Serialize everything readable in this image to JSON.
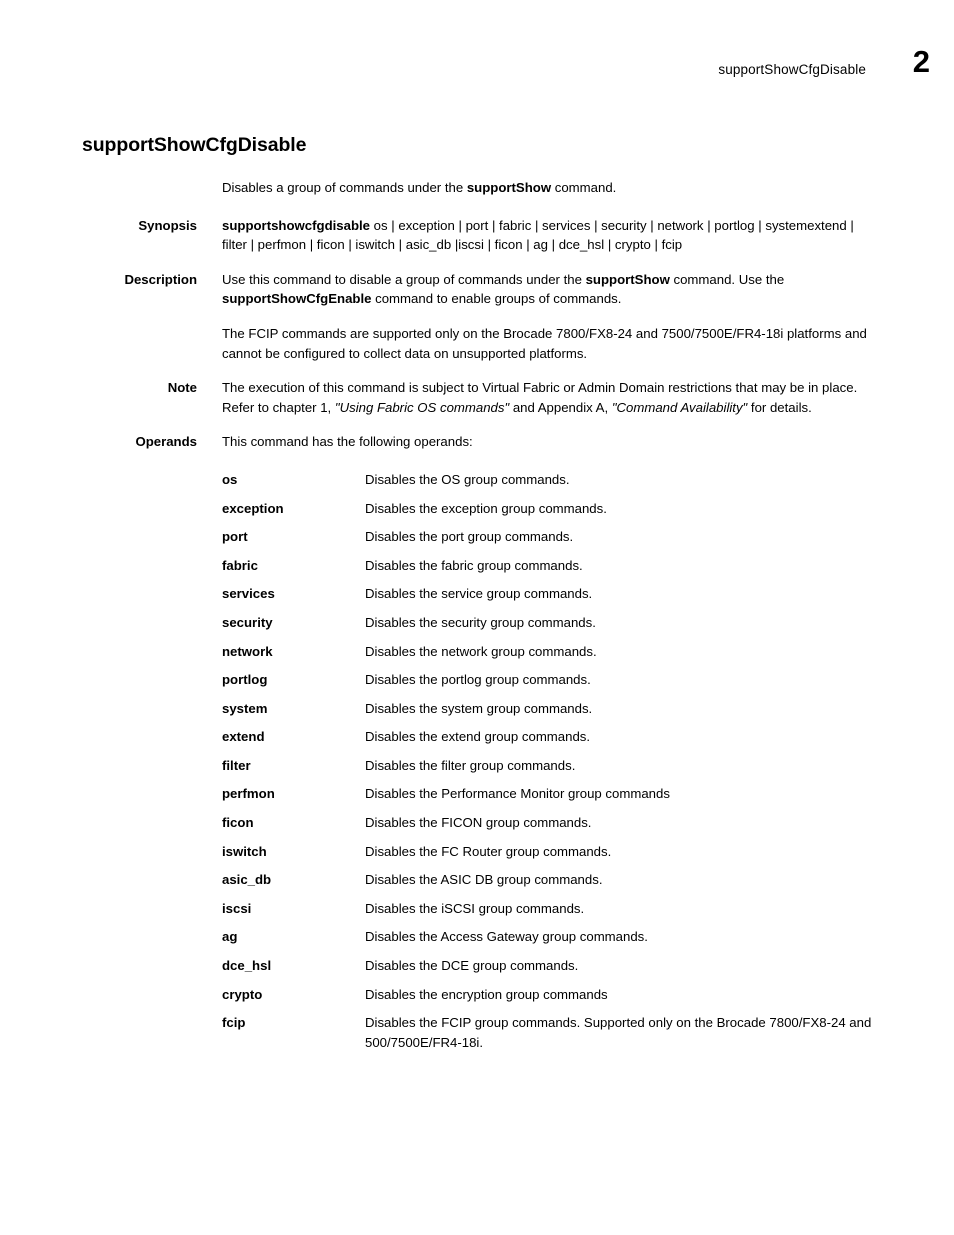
{
  "header": {
    "running_title": "supportShowCfgDisable",
    "page_number": "2"
  },
  "doc": {
    "title": "supportShowCfgDisable",
    "summary_pre": "Disables a group of commands under the ",
    "summary_bold": "supportShow",
    "summary_post": " command."
  },
  "sections": {
    "synopsis": {
      "label": "Synopsis",
      "command": "supportshowcfgdisable",
      "operands_line": " os | exception | port | fabric | services | security | network | portlog | systemextend | filter | perfmon | ficon | iswitch | asic_db |iscsi | ficon | ag | dce_hsl | crypto | fcip"
    },
    "description": {
      "label": "Description",
      "para1_pre": "Use this command to disable a group of commands under the ",
      "para1_bold1": "supportShow",
      "para1_mid": " command. Use the ",
      "para1_bold2": "supportShowCfgEnable",
      "para1_post": " command to enable groups of commands.",
      "para2": "The FCIP commands are supported only on the Brocade 7800/FX8-24 and 7500/7500E/FR4-18i platforms and cannot be configured to collect data on unsupported platforms."
    },
    "note": {
      "label": "Note",
      "text_pre": "The execution of this command is subject to Virtual Fabric or Admin Domain restrictions that may be in place. Refer to chapter 1, ",
      "italic1": "\"Using Fabric OS commands\"",
      "text_mid": " and Appendix A, ",
      "italic2": "\"Command Availability\"",
      "text_post": " for details."
    },
    "operands": {
      "label": "Operands",
      "intro": "This command has the following operands:",
      "items": [
        {
          "term": "os",
          "desc": "Disables the OS group commands."
        },
        {
          "term": "exception",
          "desc": "Disables the exception group commands."
        },
        {
          "term": "port",
          "desc": "Disables the port group commands."
        },
        {
          "term": "fabric",
          "desc": "Disables the fabric group commands."
        },
        {
          "term": "services",
          "desc": "Disables the service group commands."
        },
        {
          "term": "security",
          "desc": "Disables the security group commands."
        },
        {
          "term": "network",
          "desc": "Disables the network group commands."
        },
        {
          "term": "portlog",
          "desc": "Disables the portlog group commands."
        },
        {
          "term": "system",
          "desc": "Disables the system group commands."
        },
        {
          "term": "extend",
          "desc": "Disables the extend group commands."
        },
        {
          "term": "filter",
          "desc": "Disables the filter group commands."
        },
        {
          "term": "perfmon",
          "desc": "Disables the Performance Monitor group commands"
        },
        {
          "term": "ficon",
          "desc": "Disables the FICON group commands."
        },
        {
          "term": "iswitch",
          "desc": "Disables the FC Router group commands."
        },
        {
          "term": "asic_db",
          "desc": "Disables the ASIC DB group commands."
        },
        {
          "term": "iscsi",
          "desc": "Disables the iSCSI group commands."
        },
        {
          "term": "ag",
          "desc": "Disables the Access Gateway group commands."
        },
        {
          "term": "dce_hsl",
          "desc": "Disables the DCE group commands."
        },
        {
          "term": "crypto",
          "desc": "Disables the encryption group commands"
        },
        {
          "term": "fcip",
          "desc": "Disables the FCIP group commands. Supported only on the Brocade 7800/FX8-24 and 500/7500E/FR4-18i."
        }
      ]
    }
  }
}
